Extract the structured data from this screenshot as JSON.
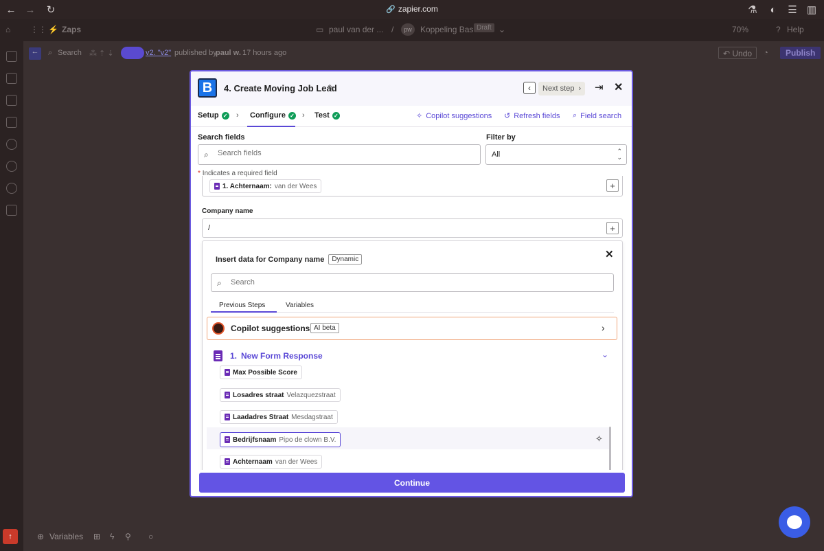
{
  "browser": {
    "url": "zapier.com"
  },
  "app_header": {
    "zaps_label": "Zaps",
    "folder": "paul van der ...",
    "separator": "/",
    "avatar_initials": "pw",
    "zap_name": "Koppeling Bas",
    "status_badge": "Draft",
    "zoom": "70%",
    "help": "Help"
  },
  "editor_bar": {
    "search": "Search",
    "version": "v2. \"v2\"",
    "published_by_prefix": "published by",
    "publisher": "paul w.",
    "published_time": "17 hours ago",
    "undo": "Undo",
    "publish": "Publish"
  },
  "modal": {
    "logo_letter": "B",
    "title": "4. Create Moving Job Lead",
    "next_step": "Next step",
    "tabs": [
      {
        "label": "Setup"
      },
      {
        "label": "Configure"
      },
      {
        "label": "Test"
      }
    ],
    "tools": {
      "copilot": "Copilot suggestions",
      "refresh": "Refresh fields",
      "field_search": "Field search"
    },
    "search_label": "Search fields",
    "search_placeholder": "Search fields",
    "filter_label": "Filter by",
    "filter_value": "All",
    "required_note": "Indicates a required field",
    "prev_field_pill": {
      "name": "1. Achternaam:",
      "value": "van der Wees"
    },
    "company_label": "Company name",
    "company_value": "/",
    "insert": {
      "title": "Insert data for Company name",
      "badge": "Dynamic",
      "search_placeholder": "Search",
      "tabs": [
        "Previous Steps",
        "Variables"
      ],
      "copilot_label": "Copilot suggestions",
      "copilot_badge": "AI beta",
      "step_number": "1.",
      "step_name": "New Form Response",
      "items": [
        {
          "name": "Max Possible Score",
          "value": ""
        },
        {
          "name": "Losadres straat",
          "value": "Velazquezstraat"
        },
        {
          "name": "Laadadres Straat",
          "value": "Mesdagstraat"
        },
        {
          "name": "Bedrijfsnaam",
          "value": "Pipo de clown B.V."
        },
        {
          "name": "Achternaam",
          "value": "van der Wees"
        }
      ]
    },
    "continue": "Continue"
  },
  "bottom_bar": {
    "variables": "Variables"
  }
}
